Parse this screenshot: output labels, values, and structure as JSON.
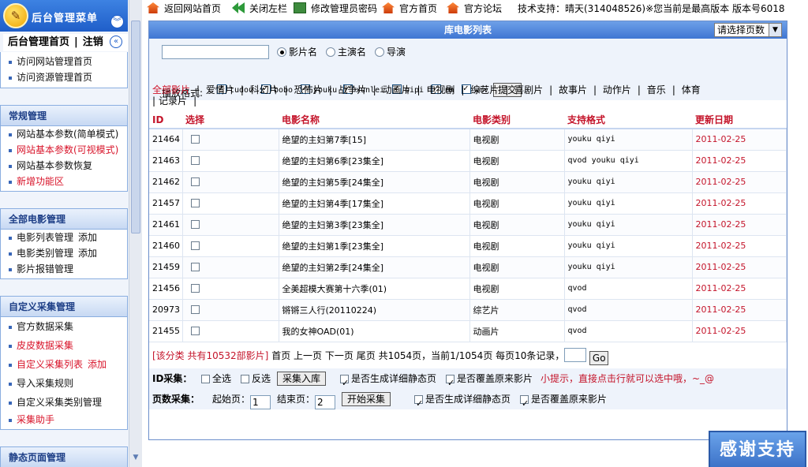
{
  "sidebar": {
    "title": "后台管理菜单",
    "home_tab": "后台管理首页",
    "logout_tab": "注销",
    "home_items": [
      "访问网站管理首页",
      "访问资源管理首页"
    ],
    "panels": [
      {
        "title": "常规管理",
        "items": [
          {
            "label": "网站基本参数(简单模式)",
            "red": false,
            "extra": ""
          },
          {
            "label": "网站基本参数(可视模式)",
            "red": true,
            "extra": ""
          },
          {
            "label": "网站基本参数恢复",
            "red": false,
            "extra": ""
          },
          {
            "label": "新增功能区",
            "red": true,
            "extra": ""
          }
        ]
      },
      {
        "title": "全部电影管理",
        "items": [
          {
            "label": "电影列表管理",
            "red": false,
            "extra": "添加"
          },
          {
            "label": "电影类别管理",
            "red": false,
            "extra": "添加"
          },
          {
            "label": "影片报错管理",
            "red": false,
            "extra": ""
          }
        ]
      },
      {
        "title": "自定义采集管理",
        "items": [
          {
            "label": "官方数据采集",
            "red": false,
            "extra": ""
          },
          {
            "label": "皮皮数据采集",
            "red": true,
            "extra": ""
          },
          {
            "label": "自定义采集列表",
            "red": true,
            "extra": "添加"
          },
          {
            "label": "导入采集规则",
            "red": false,
            "extra": ""
          },
          {
            "label": "自定义采集类别管理",
            "red": false,
            "extra": ""
          },
          {
            "label": "采集助手",
            "red": true,
            "extra": ""
          }
        ]
      },
      {
        "title": "静态页面管理",
        "items": []
      }
    ]
  },
  "topbar": {
    "links": [
      "返回网站首页",
      "关闭左栏",
      "修改管理员密码",
      "官方首页",
      "官方论坛"
    ],
    "support": "技术支持：晴天(314048526)※您当前是最高版本 版本号6018"
  },
  "main": {
    "title": "库电影列表",
    "page_select": "请选择页数",
    "search_types": [
      {
        "label": "影片名",
        "selected": true
      },
      {
        "label": "主演名",
        "selected": false
      },
      {
        "label": "导演",
        "selected": false
      }
    ],
    "format_label": "播放格式:",
    "formats": [
      "tudou",
      "bobo",
      "youku",
      "xunlei",
      "pipi",
      "rm",
      "wmv"
    ],
    "submit_label": "提交",
    "categories": [
      "全部影片",
      "爱情片",
      "科幻片",
      "恐怖片",
      "战争片",
      "动画片",
      "电视剧",
      "综艺片",
      "喜剧片",
      "故事片",
      "动作片",
      "音乐",
      "体育",
      "记录片"
    ],
    "table": {
      "headers": [
        "ID",
        "选择",
        "电影名称",
        "电影类别",
        "支持格式",
        "更新日期"
      ],
      "rows": [
        {
          "id": "21464",
          "name": "绝望的主妇第7季[15]",
          "category": "电视剧",
          "formats": "youku qiyi",
          "date": "2011-02-25"
        },
        {
          "id": "21463",
          "name": "绝望的主妇第6季[23集全]",
          "category": "电视剧",
          "formats": "qvod youku qiyi",
          "date": "2011-02-25"
        },
        {
          "id": "21462",
          "name": "绝望的主妇第5季[24集全]",
          "category": "电视剧",
          "formats": "youku qiyi",
          "date": "2011-02-25"
        },
        {
          "id": "21457",
          "name": "绝望的主妇第4季[17集全]",
          "category": "电视剧",
          "formats": "youku qiyi",
          "date": "2011-02-25"
        },
        {
          "id": "21461",
          "name": "绝望的主妇第3季[23集全]",
          "category": "电视剧",
          "formats": "youku qiyi",
          "date": "2011-02-25"
        },
        {
          "id": "21460",
          "name": "绝望的主妇第1季[23集全]",
          "category": "电视剧",
          "formats": "youku qiyi",
          "date": "2011-02-25"
        },
        {
          "id": "21459",
          "name": "绝望的主妇第2季[24集全]",
          "category": "电视剧",
          "formats": "youku qiyi",
          "date": "2011-02-25"
        },
        {
          "id": "21456",
          "name": "全美超模大赛第十六季(01)",
          "category": "电视剧",
          "formats": "qvod",
          "date": "2011-02-25"
        },
        {
          "id": "20973",
          "name": "锵锵三人行(20110224)",
          "category": "综艺片",
          "formats": "qvod",
          "date": "2011-02-25"
        },
        {
          "id": "21455",
          "name": "我的女神OAD(01)",
          "category": "动画片",
          "formats": "qvod",
          "date": "2011-02-25"
        }
      ]
    },
    "pager": {
      "summary": "[该分类 共有10532部影片]",
      "links": [
        "首页",
        "上一页",
        "下一页",
        "尾页"
      ],
      "stats": "共1054页，当前1/1054页 每页10条记录，",
      "go_label": "Go"
    },
    "id_collect": {
      "label": "ID采集：",
      "select_all": "全选",
      "invert": "反选",
      "button": "采集入库",
      "gen_static": "是否生成详细静态页",
      "overwrite": "是否覆盖原来影片",
      "hint": "小提示，直接点击行就可以选中哦，~_@"
    },
    "page_collect": {
      "label": "页数采集：",
      "start_label": "起始页：",
      "start_value": "1",
      "end_label": "结束页：",
      "end_value": "2",
      "button": "开始采集",
      "gen_static": "是否生成详细静态页",
      "overwrite": "是否覆盖原来影片"
    }
  },
  "thanks_badge": "感谢支持"
}
